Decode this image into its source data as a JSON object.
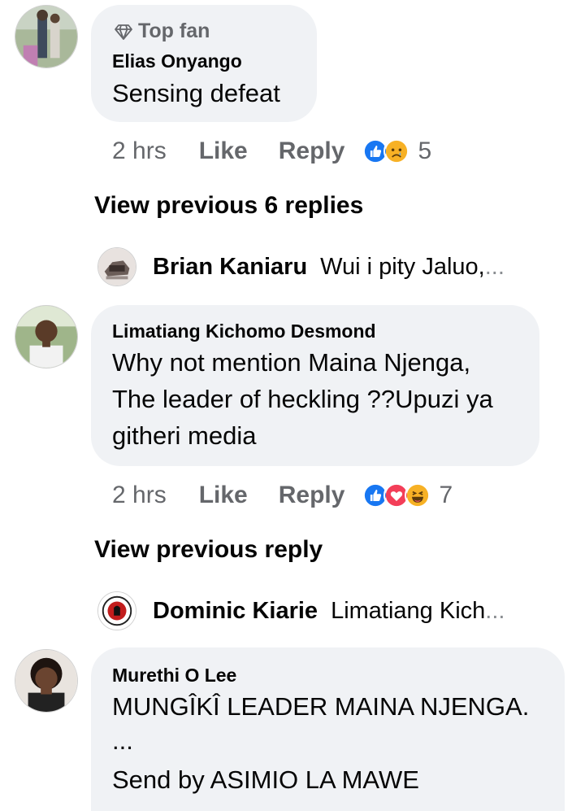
{
  "comments": [
    {
      "badge": "Top fan",
      "author": "Elias Onyango",
      "lines": [
        "Sensing defeat"
      ],
      "time": "2 hrs",
      "like_label": "Like",
      "reply_label": "Reply",
      "reactions": [
        "like",
        "sad"
      ],
      "reaction_count": "5"
    },
    {
      "author": "Limatiang Kichomo Desmond",
      "lines": [
        "Why not mention  Maina Njenga,",
        "The leader of heckling ??Upuzi ya",
        "githeri media"
      ],
      "time": "2 hrs",
      "like_label": "Like",
      "reply_label": "Reply",
      "reactions": [
        "like",
        "love",
        "haha"
      ],
      "reaction_count": "7"
    },
    {
      "author": "Murethi O Lee",
      "lines": [
        "MUNGÎKÎ LEADER MAINA NJENGA.",
        "...",
        "Send by ASIMIO LA MAWE"
      ]
    }
  ],
  "view_previous": [
    "View previous 6 replies",
    "View previous reply"
  ],
  "reply_previews": [
    {
      "name": "Brian Kaniaru",
      "snippet": "Wui i pity Jaluo,",
      "ellipsis": "..."
    },
    {
      "name": "Dominic Kiarie",
      "snippet": "Limatiang Kich",
      "ellipsis": "..."
    }
  ],
  "colors": {
    "bubble": "#f0f2f5",
    "secondary_text": "#65676b",
    "like_blue": "#1877f2",
    "love_red": "#f33e58",
    "emoji_yellow": "#f7b125"
  }
}
